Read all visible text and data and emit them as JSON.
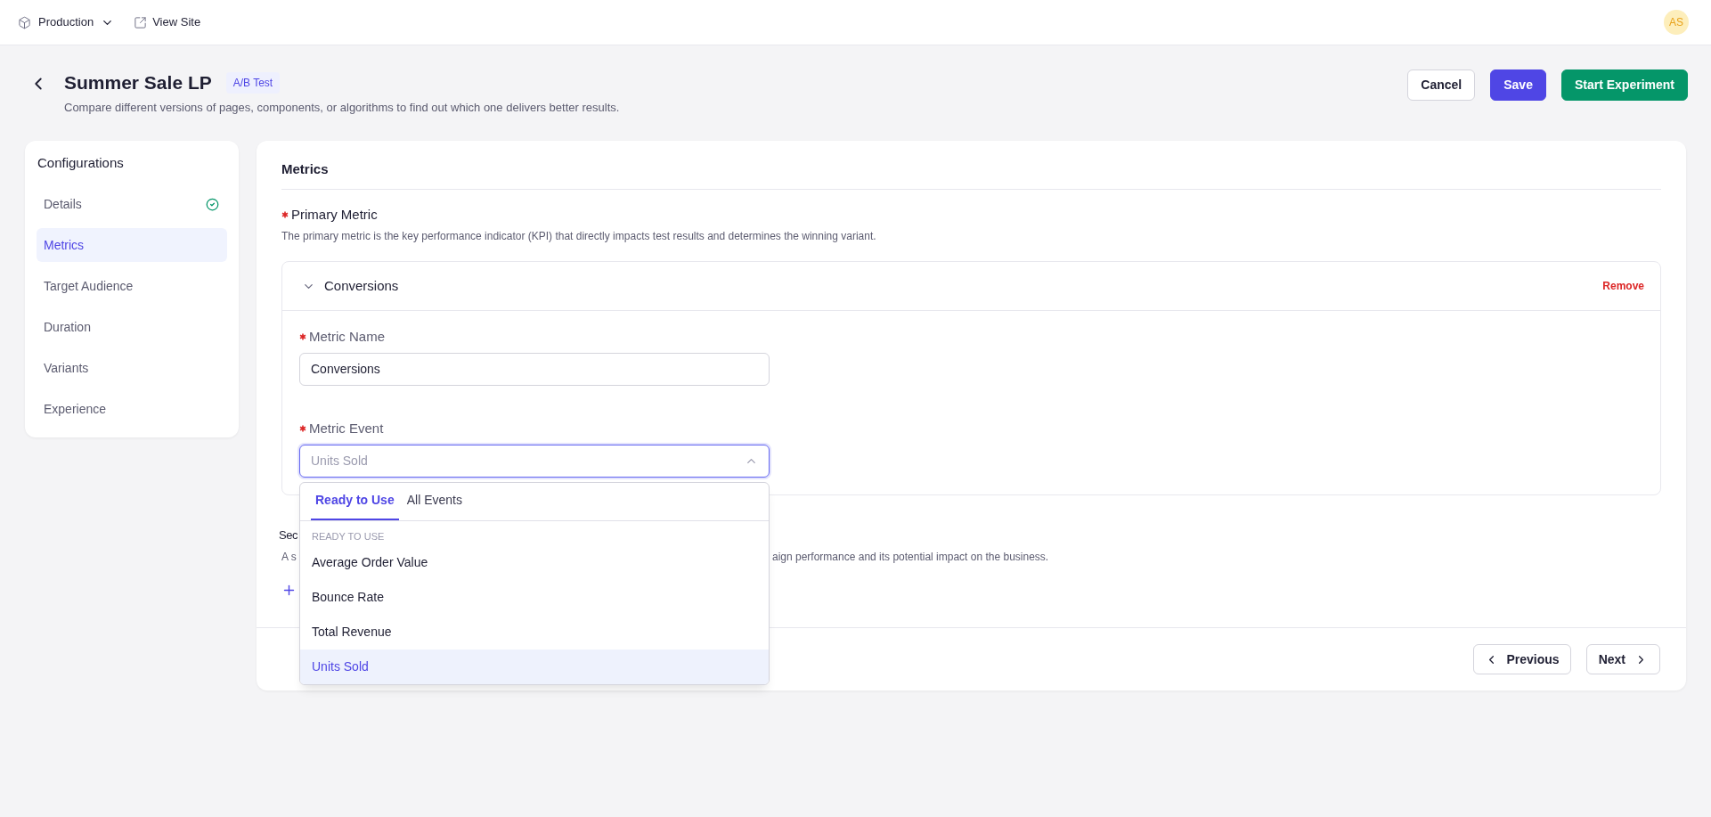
{
  "top_bar": {
    "environment": "Production",
    "view_site": "View Site",
    "avatar": "AS"
  },
  "header": {
    "title": "Summer Sale LP",
    "badge": "A/B Test",
    "description": "Compare different versions of pages, components, or algorithms to find out which one delivers better results."
  },
  "actions": [
    {
      "label": "Cancel",
      "kind": "outline"
    },
    {
      "label": "Save",
      "kind": "primary"
    },
    {
      "label": "Start Experiment",
      "kind": "success"
    }
  ],
  "sidebar": {
    "title": "Configurations",
    "items": [
      {
        "label": "Details",
        "selected": false,
        "completed": true
      },
      {
        "label": "Metrics",
        "selected": true,
        "completed": false
      },
      {
        "label": "Target Audience",
        "selected": false,
        "completed": false
      },
      {
        "label": "Duration",
        "selected": false,
        "completed": false
      },
      {
        "label": "Variants",
        "selected": false,
        "completed": false
      },
      {
        "label": "Experience",
        "selected": false,
        "completed": false
      }
    ]
  },
  "panel": {
    "title": "Metrics",
    "primary_metric": {
      "label": "Primary Metric",
      "required": true,
      "description": "The primary metric is the key performance indicator (KPI) that directly impacts test results and determines the winning variant."
    },
    "metric_card": {
      "title": "Conversions",
      "expanded": true,
      "remove": "Remove",
      "fields": [
        {
          "kind": "text",
          "label": "Metric Name",
          "required": true,
          "value": "Conversions"
        },
        {
          "kind": "select",
          "label": "Metric Event",
          "required": true,
          "placeholder": "Units Sold",
          "open": true
        }
      ]
    },
    "dropdown": {
      "tabs": [
        {
          "label": "Ready to Use",
          "selected": true
        },
        {
          "label": "All Events",
          "selected": false
        }
      ],
      "group": "READY TO USE",
      "options": [
        {
          "label": "Average Order Value",
          "selected": false
        },
        {
          "label": "Bounce Rate",
          "selected": false
        },
        {
          "label": "Total Revenue",
          "selected": false
        },
        {
          "label": "Units Sold",
          "selected": true
        }
      ]
    },
    "secondary": {
      "title_start": "Sec",
      "description_start": "A s",
      "description_end": "aign performance and its potential impact on the business."
    },
    "footer": {
      "previous": "Previous",
      "next": "Next"
    }
  }
}
